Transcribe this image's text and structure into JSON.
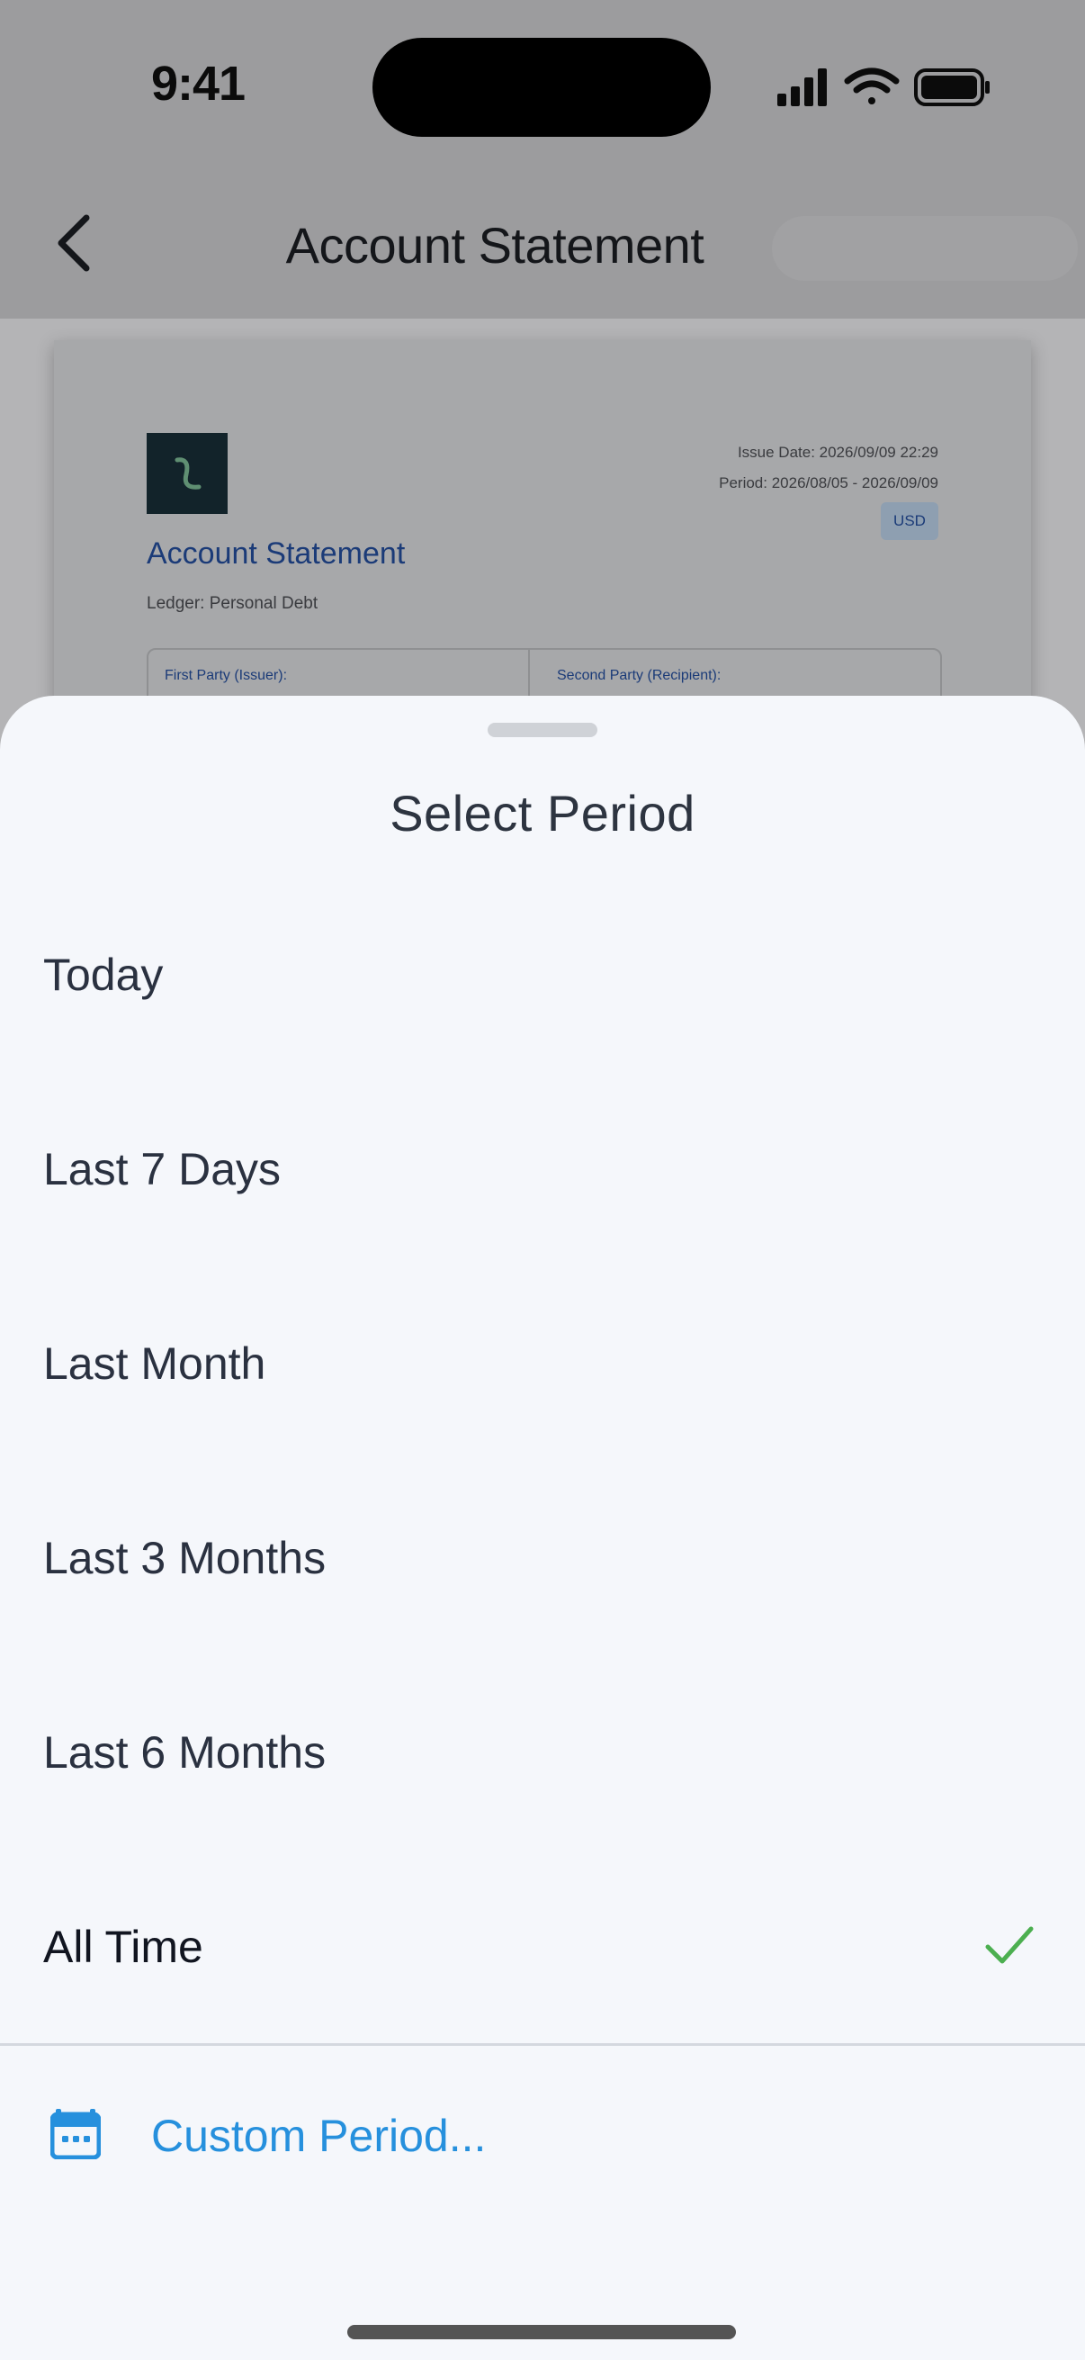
{
  "status_bar": {
    "time": "9:41"
  },
  "nav": {
    "title": "Account Statement"
  },
  "document": {
    "title": "Account Statement",
    "ledger": "Ledger: Personal Debt",
    "issue_date": "Issue Date: 2026/09/09 22:29",
    "period": "Period: 2026/08/05 - 2026/09/09",
    "currency": "USD",
    "first_party": "First Party (Issuer):",
    "second_party": "Second Party (Recipient):"
  },
  "sheet": {
    "title": "Select Period",
    "options": [
      {
        "label": "Today"
      },
      {
        "label": "Last 7 Days"
      },
      {
        "label": "Last Month"
      },
      {
        "label": "Last 3 Months"
      },
      {
        "label": "Last 6 Months"
      },
      {
        "label": "All Time",
        "selected": true
      }
    ],
    "custom_label": "Custom Period..."
  },
  "colors": {
    "accent": "#2690dd",
    "check": "#4caf50",
    "sheet_bg": "#f5f7fb"
  }
}
